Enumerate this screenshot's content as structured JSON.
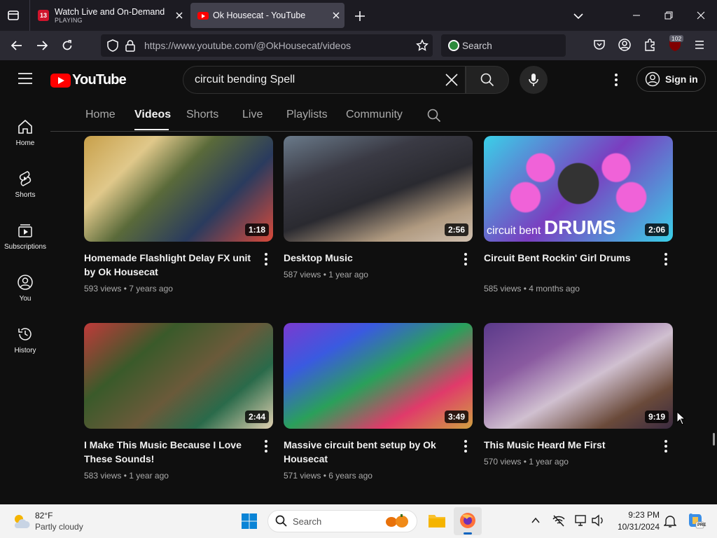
{
  "browser": {
    "tabs": [
      {
        "title": "Watch Live and On-Demand Vi",
        "subtitle": "PLAYING",
        "favicon_letter": "13",
        "active": false
      },
      {
        "title": "Ok Housecat - YouTube",
        "active": true
      }
    ],
    "url": "https://www.youtube.com/@OkHousecat/videos",
    "search_placeholder": "Search",
    "extension_badge": "102"
  },
  "youtube": {
    "logo_text": "YouTube",
    "search_query": "circuit bending Spell",
    "sign_in_label": "Sign in",
    "left_nav": [
      {
        "label": "Home",
        "icon": "home-icon"
      },
      {
        "label": "Shorts",
        "icon": "shorts-icon"
      },
      {
        "label": "Subscriptions",
        "icon": "subscriptions-icon"
      },
      {
        "label": "You",
        "icon": "you-icon"
      },
      {
        "label": "History",
        "icon": "history-icon"
      }
    ],
    "channel_tabs": [
      "Home",
      "Videos",
      "Shorts",
      "Live",
      "Playlists",
      "Community"
    ],
    "active_tab": "Videos",
    "videos": [
      {
        "title": "Homemade Flashlight Delay FX unit by Ok Housecat",
        "views": "593 views",
        "age": "7 years ago",
        "duration": "1:18"
      },
      {
        "title": "Desktop Music",
        "views": "587 views",
        "age": "1 year ago",
        "duration": "2:56"
      },
      {
        "title": "Circuit Bent Rockin' Girl Drums",
        "views": "585 views",
        "age": "4 months ago",
        "duration": "2:06",
        "thumb_text": "circuit bent DRUMS"
      },
      {
        "title": "I Make This Music Because I Love These Sounds!",
        "views": "583 views",
        "age": "1 year ago",
        "duration": "2:44"
      },
      {
        "title": "Massive circuit bent setup by Ok Housecat",
        "views": "571 views",
        "age": "6 years ago",
        "duration": "3:49"
      },
      {
        "title": "This Music Heard Me First",
        "views": "570 views",
        "age": "1 year ago",
        "duration": "9:19"
      }
    ]
  },
  "taskbar": {
    "weather_temp": "82°F",
    "weather_desc": "Partly cloudy",
    "search_label": "Search",
    "time": "9:23 PM",
    "date": "10/31/2024"
  },
  "colors": {
    "yt_red": "#ff0000",
    "browser_dark": "#1c1b22",
    "yt_bg": "#0f0f0f"
  }
}
